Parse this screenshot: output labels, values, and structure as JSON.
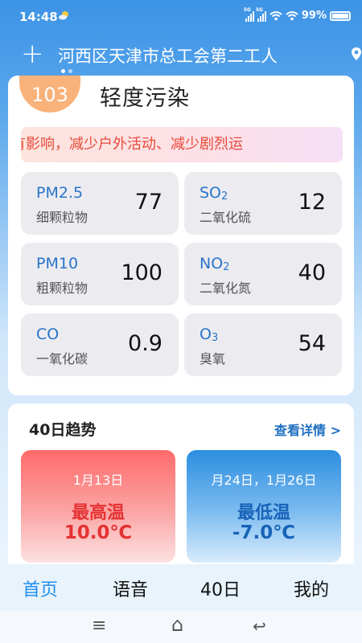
{
  "status": {
    "time": "14:48",
    "sim1": "5G",
    "sim2": "5G",
    "battery": "99%"
  },
  "header": {
    "add_symbol": "+",
    "location": "河西区天津市总工会第二工人"
  },
  "aqi": {
    "value": "103",
    "level": "轻度污染",
    "advice": "有影响，减少户外活动、减少剧烈运",
    "tiles": [
      {
        "name": "PM2.5",
        "name_sub": "",
        "cn": "细颗粒物",
        "value": "77"
      },
      {
        "name": "SO",
        "name_sub": "2",
        "cn": "二氧化硫",
        "value": "12"
      },
      {
        "name": "PM10",
        "name_sub": "",
        "cn": "粗颗粒物",
        "value": "100"
      },
      {
        "name": "NO",
        "name_sub": "2",
        "cn": "二氧化氮",
        "value": "40"
      },
      {
        "name": "CO",
        "name_sub": "",
        "cn": "一氧化碳",
        "value": "0.9"
      },
      {
        "name": "O",
        "name_sub": "3",
        "cn": "臭氧",
        "value": "54"
      }
    ]
  },
  "trend": {
    "title": "40日趋势",
    "more_label": "查看详情 >",
    "high": {
      "date": "1月13日",
      "label": "最高温",
      "temp": "10.0℃"
    },
    "low": {
      "date": "月24日，1月26日",
      "label": "最低温",
      "temp": "-7.0℃"
    }
  },
  "tabs": [
    {
      "label": "首页",
      "active": true
    },
    {
      "label": "语音",
      "active": false
    },
    {
      "label": "40日",
      "active": false
    },
    {
      "label": "我的",
      "active": false
    }
  ],
  "nav": {
    "menu": "≡",
    "home": "⌂",
    "back": "↩"
  },
  "colors": {
    "accent": "#1f8ef1",
    "aqi_badge": "#f8b27a",
    "warning_text": "#e84a3a",
    "high_temp": "#e63232",
    "low_temp": "#1763b8"
  }
}
